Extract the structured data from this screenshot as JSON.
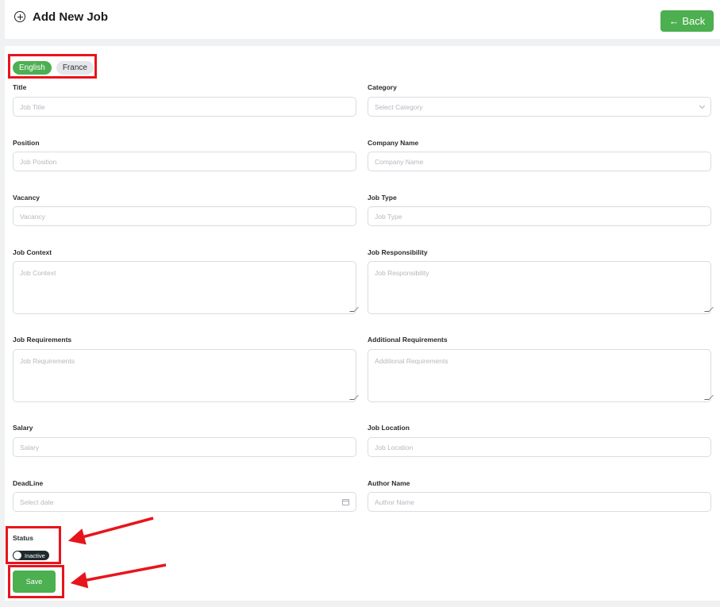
{
  "header": {
    "title": "Add New Job",
    "back_label": "← Back"
  },
  "languages": [
    "English",
    "France"
  ],
  "form": {
    "title": {
      "label": "Title",
      "placeholder": "Job Title"
    },
    "category": {
      "label": "Category",
      "placeholder": "Select Category"
    },
    "position": {
      "label": "Position",
      "placeholder": "Job Position"
    },
    "company": {
      "label": "Company Name",
      "placeholder": "Company Name"
    },
    "vacancy": {
      "label": "Vacancy",
      "placeholder": "Vacancy"
    },
    "job_type": {
      "label": "Job Type",
      "placeholder": "Job Type"
    },
    "context": {
      "label": "Job Context",
      "placeholder": "Job Context"
    },
    "responsibility": {
      "label": "Job Responsibility",
      "placeholder": "Job Responsibility"
    },
    "requirements": {
      "label": "Job Requirements",
      "placeholder": "Job Requirements"
    },
    "additional": {
      "label": "Additional Requirements",
      "placeholder": "Additional Requirements"
    },
    "salary": {
      "label": "Salary",
      "placeholder": "Salary"
    },
    "location": {
      "label": "Job Location",
      "placeholder": "Job Location"
    },
    "deadline": {
      "label": "DeadLine",
      "placeholder": "Select date"
    },
    "author": {
      "label": "Author Name",
      "placeholder": "Author Name"
    }
  },
  "status": {
    "label": "Status",
    "toggle_label": "Inactive"
  },
  "save_label": "Save",
  "colors": {
    "accent": "#4caf50",
    "annotation": "#e8141c"
  },
  "icons": {
    "add": "add-circle-icon",
    "select": "chevron-down-icon",
    "date": "calendar-icon"
  }
}
